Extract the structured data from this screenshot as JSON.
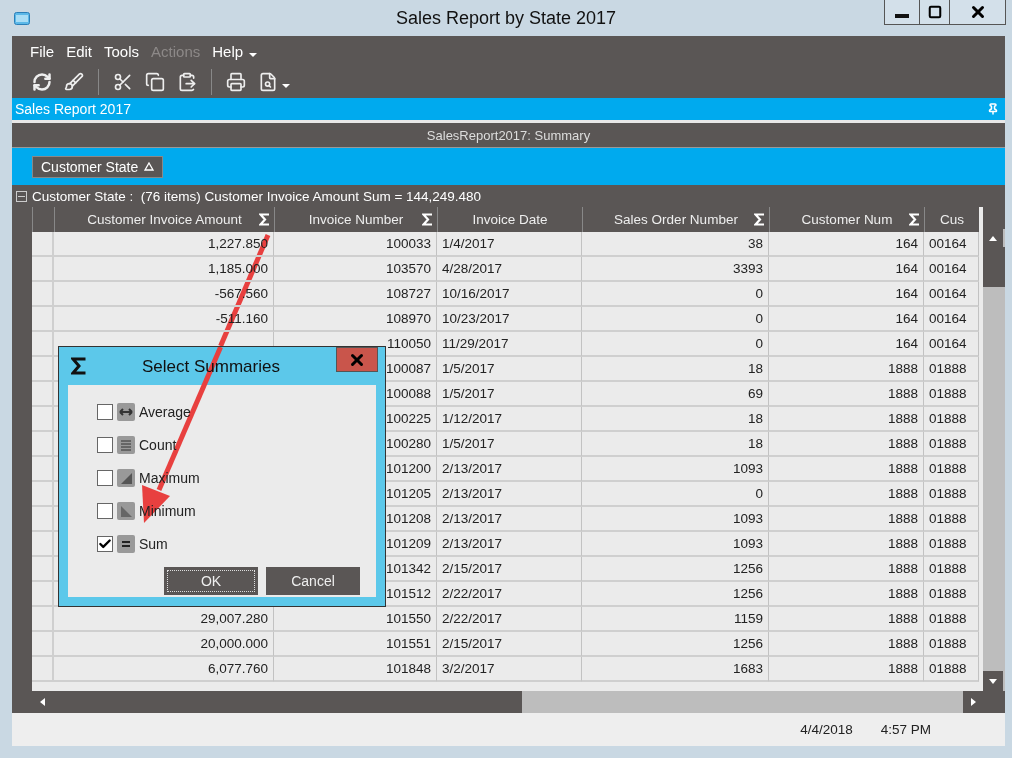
{
  "window": {
    "title": "Sales Report by State 2017"
  },
  "menu": [
    {
      "label": "File",
      "disabled": false
    },
    {
      "label": "Edit",
      "disabled": false
    },
    {
      "label": "Tools",
      "disabled": false
    },
    {
      "label": "Actions",
      "disabled": true
    },
    {
      "label": "Help",
      "disabled": false
    }
  ],
  "panel": {
    "title": "Sales Report 2017"
  },
  "view": {
    "title": "SalesReport2017: Summary"
  },
  "group_by": [
    {
      "label": "Customer State"
    }
  ],
  "group": {
    "expanded": true,
    "label": "Customer State :  (76 items) Customer Invoice Amount Sum = 144,249.480"
  },
  "table": {
    "columns": [
      {
        "label": "Customer Invoice Amount",
        "summary": true
      },
      {
        "label": "Invoice Number",
        "summary": true
      },
      {
        "label": "Invoice Date",
        "summary": false
      },
      {
        "label": "Sales Order Number",
        "summary": true
      },
      {
        "label": "Customer Num",
        "summary": true
      },
      {
        "label": "Cus",
        "summary": false
      }
    ],
    "rows": [
      [
        "1,227.850",
        "100033",
        "1/4/2017",
        "38",
        "164",
        "00164"
      ],
      [
        "1,185.000",
        "103570",
        "4/28/2017",
        "3393",
        "164",
        "00164"
      ],
      [
        "-567.560",
        "108727",
        "10/16/2017",
        "0",
        "164",
        "00164"
      ],
      [
        "-511.160",
        "108970",
        "10/23/2017",
        "0",
        "164",
        "00164"
      ],
      [
        null,
        "110050",
        "11/29/2017",
        "0",
        "164",
        "00164"
      ],
      [
        null,
        "100087",
        "1/5/2017",
        "18",
        "1888",
        "01888"
      ],
      [
        null,
        "100088",
        "1/5/2017",
        "69",
        "1888",
        "01888"
      ],
      [
        null,
        "100225",
        "1/12/2017",
        "18",
        "1888",
        "01888"
      ],
      [
        null,
        "100280",
        "1/5/2017",
        "18",
        "1888",
        "01888"
      ],
      [
        null,
        "101200",
        "2/13/2017",
        "1093",
        "1888",
        "01888"
      ],
      [
        null,
        "101205",
        "2/13/2017",
        "0",
        "1888",
        "01888"
      ],
      [
        null,
        "101208",
        "2/13/2017",
        "1093",
        "1888",
        "01888"
      ],
      [
        null,
        "101209",
        "2/13/2017",
        "1093",
        "1888",
        "01888"
      ],
      [
        null,
        "101342",
        "2/15/2017",
        "1256",
        "1888",
        "01888"
      ],
      [
        null,
        "101512",
        "2/22/2017",
        "1256",
        "1888",
        "01888"
      ],
      [
        "29,007.280",
        "101550",
        "2/22/2017",
        "1159",
        "1888",
        "01888"
      ],
      [
        "20,000.000",
        "101551",
        "2/15/2017",
        "1256",
        "1888",
        "01888"
      ],
      [
        "6,077.760",
        "101848",
        "3/2/2017",
        "1683",
        "1888",
        "01888"
      ]
    ]
  },
  "status_bar": {
    "date": "4/4/2018",
    "time": "4:57 PM"
  },
  "dialog": {
    "title": "Select Summaries",
    "options": [
      {
        "label": "Average",
        "kind": "average",
        "checked": false
      },
      {
        "label": "Count",
        "kind": "count",
        "checked": false
      },
      {
        "label": "Maximum",
        "kind": "maximum",
        "checked": false
      },
      {
        "label": "Minimum",
        "kind": "minimum",
        "checked": false
      },
      {
        "label": "Sum",
        "kind": "sum",
        "checked": true
      }
    ],
    "buttons": [
      {
        "label": "OK",
        "focused": true
      },
      {
        "label": "Cancel",
        "focused": false
      }
    ]
  }
}
